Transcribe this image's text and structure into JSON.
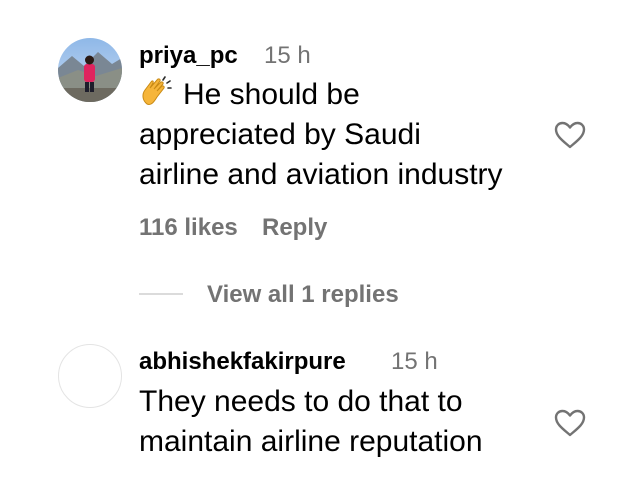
{
  "comments": [
    {
      "username": "priya_pc",
      "time": "15 h",
      "emoji": "clapping-hands",
      "lines": [
        "He should be",
        "appreciated by Saudi",
        "airline and aviation industry"
      ],
      "likes": "116 likes",
      "reply": "Reply",
      "view_replies": "View all 1 replies"
    },
    {
      "username": "abhishekfakirpure",
      "time": "15 h",
      "lines": [
        "They needs to do that to",
        "maintain airline reputation"
      ]
    }
  ],
  "colors": {
    "secondary_text": "#737373",
    "divider": "#dbdbdb",
    "heart_stroke": "#737373"
  }
}
